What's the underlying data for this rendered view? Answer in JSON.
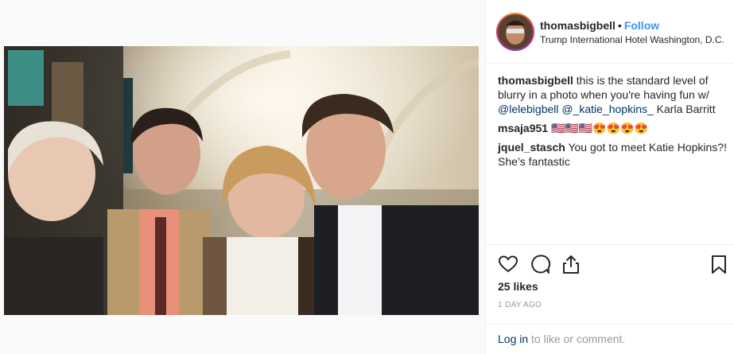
{
  "header": {
    "username": "thomasbigbell",
    "dot": "•",
    "follow_label": "Follow",
    "location": "Trump International Hotel Washington, D.C."
  },
  "caption": {
    "username": "thomasbigbell",
    "text": "this is the standard level of blurry in a photo when you're having fun w/",
    "mention1": "@lelebigbell",
    "mention2": "@_katie_hopkins_",
    "tail": "Karla Barritt"
  },
  "comments": [
    {
      "username": "msaja951",
      "text": "🇺🇸🇺🇸🇺🇸😍😍😍😍"
    },
    {
      "username": "jquel_stasch",
      "text": "You got to meet Katie Hopkins?! She’s fantastic"
    }
  ],
  "actions": {
    "like_icon": "heart-outline",
    "comment_icon": "speech-bubble",
    "share_icon": "share-upload",
    "save_icon": "bookmark-outline"
  },
  "likes": "25 likes",
  "timestamp": "1 DAY AGO",
  "login": {
    "link": "Log in",
    "text": "to like or comment."
  },
  "colors": {
    "link_blue": "#3897f0",
    "mention_blue": "#003569",
    "muted": "#999999",
    "border": "#efefef"
  }
}
